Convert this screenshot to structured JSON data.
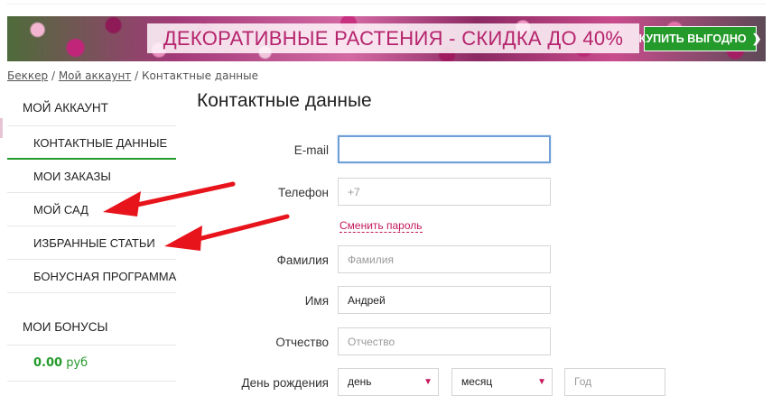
{
  "banner": {
    "text": "ДЕКОРАТИВНЫЕ РАСТЕНИЯ - СКИДКА ДО 40%",
    "button": "КУПИТЬ ВЫГОДНО",
    "button_icon": "chevron-right-icon"
  },
  "breadcrumb": {
    "items": [
      "Беккер",
      "Мой аккаунт",
      "Контактные данные"
    ],
    "separator": "/"
  },
  "sidebar": {
    "account_title": "МОЙ АККАУНТ",
    "items": [
      "КОНТАКТНЫЕ ДАННЫЕ",
      "МОИ ЗАКАЗЫ",
      "МОЙ САД",
      "ИЗБРАННЫЕ СТАТЬИ",
      "БОНУСНАЯ ПРОГРАММА"
    ],
    "active_index": 0,
    "bonus_title": "МОИ БОНУСЫ",
    "bonus_value": "0.00",
    "bonus_currency": "руб"
  },
  "main": {
    "title": "Контактные данные",
    "fields": {
      "email": {
        "label": "E-mail",
        "value": "",
        "placeholder": ""
      },
      "phone": {
        "label": "Телефон",
        "value": "",
        "placeholder": "+7"
      },
      "change_password": "Сменить пароль",
      "last_name": {
        "label": "Фамилия",
        "value": "",
        "placeholder": "Фамилия"
      },
      "first_name": {
        "label": "Имя",
        "value": "Андрей",
        "placeholder": ""
      },
      "middle_name": {
        "label": "Отчество",
        "value": "",
        "placeholder": "Отчество"
      },
      "birthday": {
        "label": "День рождения",
        "day": "день",
        "month": "месяц",
        "year": "Год"
      }
    }
  },
  "colors": {
    "accent_green": "#239a2a",
    "link_pink": "#c2185b",
    "banner_text": "#b5246d",
    "annotation_arrow": "#e8141b"
  }
}
